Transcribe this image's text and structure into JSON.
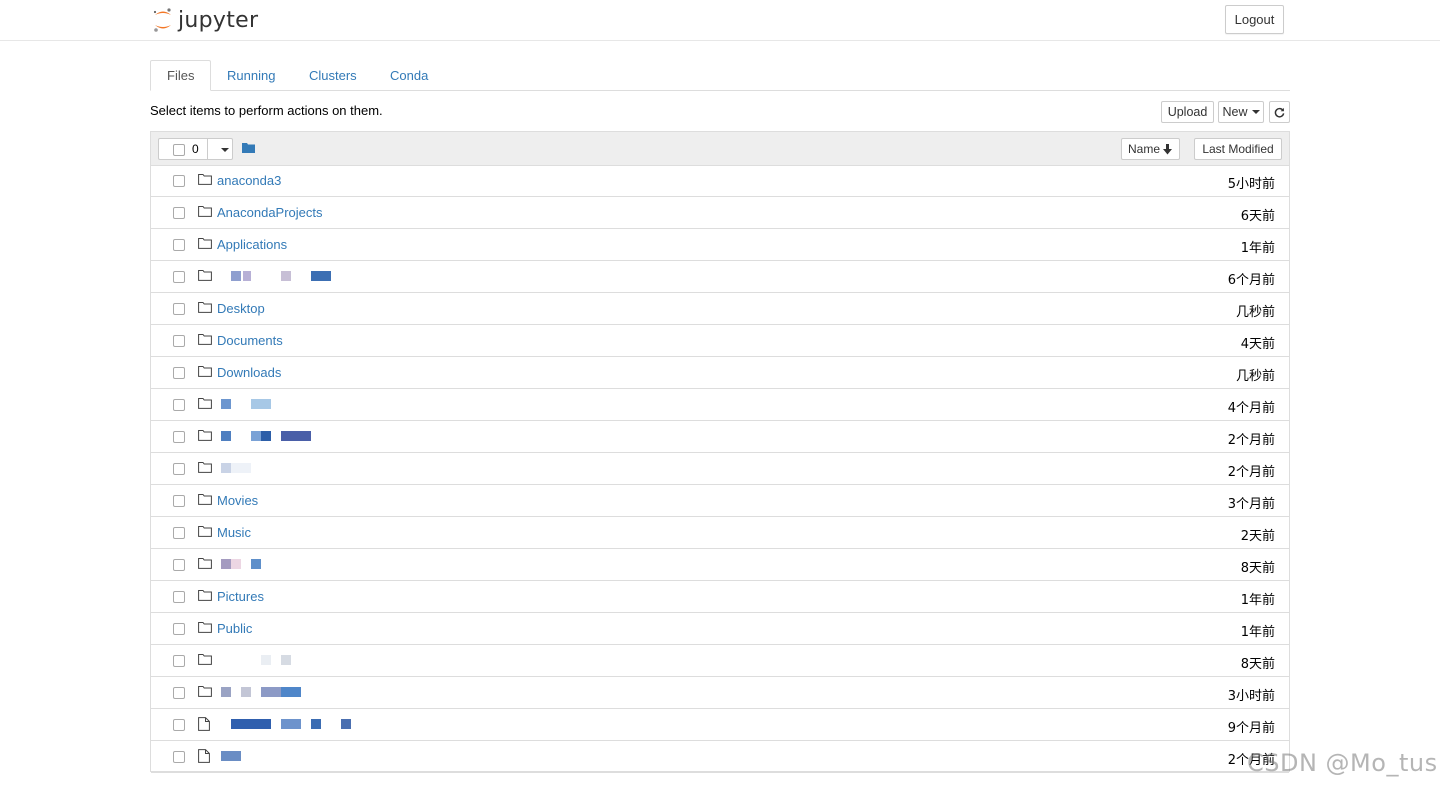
{
  "header": {
    "logo_text": "jupyter",
    "logout_label": "Logout"
  },
  "tabs": [
    {
      "label": "Files",
      "active": true
    },
    {
      "label": "Running",
      "active": false
    },
    {
      "label": "Clusters",
      "active": false
    },
    {
      "label": "Conda",
      "active": false
    }
  ],
  "toolbar": {
    "hint": "Select items to perform actions on them.",
    "upload_label": "Upload",
    "new_label": "New"
  },
  "list_header": {
    "selected_count": "0",
    "sort_name_label": "Name",
    "sort_modified_label": "Last Modified"
  },
  "items": [
    {
      "type": "folder",
      "name": "anaconda3",
      "modified": "5小时前"
    },
    {
      "type": "folder",
      "name": "AnacondaProjects",
      "modified": "6天前"
    },
    {
      "type": "folder",
      "name": "Applications",
      "modified": "1年前"
    },
    {
      "type": "folder",
      "name": "",
      "modified": "6个月前",
      "redacted": true
    },
    {
      "type": "folder",
      "name": "Desktop",
      "modified": "几秒前"
    },
    {
      "type": "folder",
      "name": "Documents",
      "modified": "4天前"
    },
    {
      "type": "folder",
      "name": "Downloads",
      "modified": "几秒前"
    },
    {
      "type": "folder",
      "name": "",
      "modified": "4个月前",
      "redacted": true
    },
    {
      "type": "folder",
      "name": "",
      "modified": "2个月前",
      "redacted": true
    },
    {
      "type": "folder",
      "name": "",
      "modified": "2个月前",
      "redacted": true
    },
    {
      "type": "folder",
      "name": "Movies",
      "modified": "3个月前"
    },
    {
      "type": "folder",
      "name": "Music",
      "modified": "2天前"
    },
    {
      "type": "folder",
      "name": "",
      "modified": "8天前",
      "redacted": true
    },
    {
      "type": "folder",
      "name": "Pictures",
      "modified": "1年前"
    },
    {
      "type": "folder",
      "name": "Public",
      "modified": "1年前"
    },
    {
      "type": "folder",
      "name": "",
      "modified": "8天前",
      "redacted": true
    },
    {
      "type": "folder",
      "name": "",
      "modified": "3小时前",
      "redacted": true
    },
    {
      "type": "file",
      "name": "",
      "modified": "9个月前",
      "redacted": true
    },
    {
      "type": "file",
      "name": "",
      "modified": "2个月前",
      "redacted": true
    }
  ],
  "watermark": "CSDN @Mo_tus",
  "colors": {
    "link": "#337ab7",
    "logo_orange": "#f37726"
  }
}
